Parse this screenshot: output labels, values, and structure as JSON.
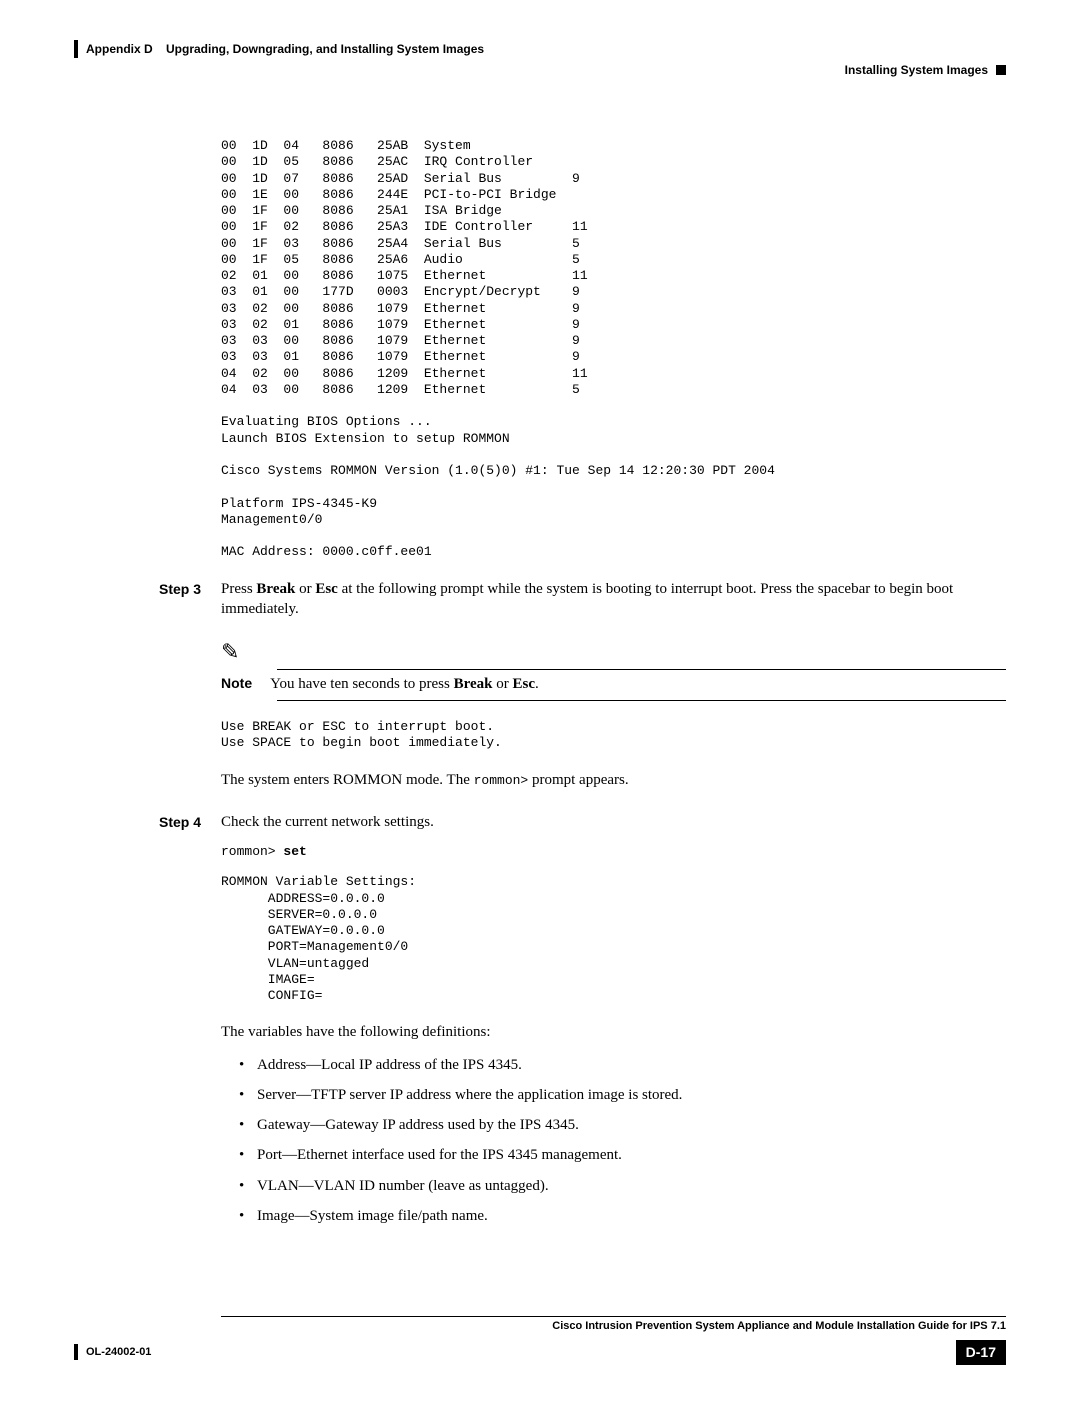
{
  "header": {
    "appendix": "Appendix D",
    "chapterTitle": "Upgrading, Downgrading, and Installing System Images",
    "sectionTitle": "Installing System Images"
  },
  "codeBlock1": "00  1D  04   8086   25AB  System\n00  1D  05   8086   25AC  IRQ Controller\n00  1D  07   8086   25AD  Serial Bus         9\n00  1E  00   8086   244E  PCI-to-PCI Bridge\n00  1F  00   8086   25A1  ISA Bridge\n00  1F  02   8086   25A3  IDE Controller     11\n00  1F  03   8086   25A4  Serial Bus         5\n00  1F  05   8086   25A6  Audio              5\n02  01  00   8086   1075  Ethernet           11\n03  01  00   177D   0003  Encrypt/Decrypt    9\n03  02  00   8086   1079  Ethernet           9\n03  02  01   8086   1079  Ethernet           9\n03  03  00   8086   1079  Ethernet           9\n03  03  01   8086   1079  Ethernet           9\n04  02  00   8086   1209  Ethernet           11\n04  03  00   8086   1209  Ethernet           5\n\nEvaluating BIOS Options ...\nLaunch BIOS Extension to setup ROMMON\n\nCisco Systems ROMMON Version (1.0(5)0) #1: Tue Sep 14 12:20:30 PDT 2004\n\nPlatform IPS-4345-K9\nManagement0/0\n\nMAC Address: 0000.c0ff.ee01",
  "step3": {
    "label": "Step 3",
    "text_before": "Press ",
    "b1": "Break",
    "mid1": " or ",
    "b2": "Esc",
    "text_after": " at the following prompt while the system is booting to interrupt boot. Press the spacebar to begin boot immediately."
  },
  "note": {
    "label": "Note",
    "text_before": "You have ten seconds to press ",
    "b1": "Break",
    "mid1": " or ",
    "b2": "Esc",
    "period": "."
  },
  "codeBlock2": "Use BREAK or ESC to interrupt boot.\nUse SPACE to begin boot immediately.",
  "rommonLine": {
    "before": "The system enters ROMMON mode. The ",
    "prompt": "rommon>",
    "after": " prompt appears."
  },
  "step4": {
    "label": "Step 4",
    "text": "Check the current network settings."
  },
  "codeBlock3_prompt": "rommon> ",
  "codeBlock3_cmd": "set",
  "codeBlock4": "ROMMON Variable Settings:\n      ADDRESS=0.0.0.0\n      SERVER=0.0.0.0\n      GATEWAY=0.0.0.0\n      PORT=Management0/0\n      VLAN=untagged\n      IMAGE=\n      CONFIG=",
  "varsIntro": "The variables have the following definitions:",
  "bullets": [
    "Address—Local IP address of the IPS 4345.",
    "Server—TFTP server IP address where the application image is stored.",
    "Gateway—Gateway IP address used by the IPS 4345.",
    "Port—Ethernet interface used for the IPS 4345 management.",
    "VLAN—VLAN ID number (leave as untagged).",
    "Image—System image file/path name."
  ],
  "footer": {
    "guideTitle": "Cisco Intrusion Prevention System Appliance and Module Installation Guide for IPS 7.1",
    "docNumber": "OL-24002-01",
    "pageNumber": "D-17"
  }
}
